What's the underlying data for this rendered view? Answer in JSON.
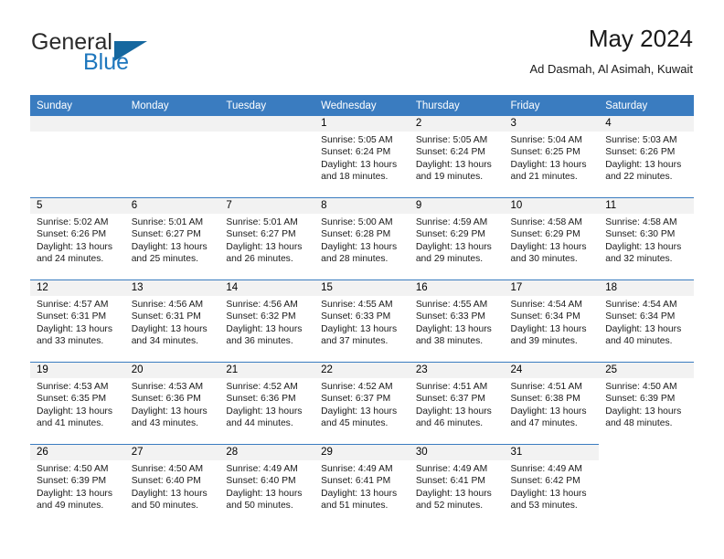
{
  "branding": {
    "logo_text_primary": "General",
    "logo_text_secondary": "Blue",
    "logo_triangle_color": "#15679f",
    "logo_secondary_color": "#1d76bd"
  },
  "header": {
    "title": "May 2024",
    "subtitle": "Ad Dasmah, Al Asimah, Kuwait"
  },
  "theme": {
    "header_bg": "#3a7cc0",
    "daynum_bg": "#f2f2f2",
    "cell_bg": "#ffffff",
    "text": "#1a1a1a"
  },
  "calendar": {
    "weekday_headers": [
      "Sunday",
      "Monday",
      "Tuesday",
      "Wednesday",
      "Thursday",
      "Friday",
      "Saturday"
    ],
    "weeks": [
      [
        {
          "day": "",
          "lines": []
        },
        {
          "day": "",
          "lines": []
        },
        {
          "day": "",
          "lines": []
        },
        {
          "day": "1",
          "lines": [
            "Sunrise: 5:05 AM",
            "Sunset: 6:24 PM",
            "Daylight: 13 hours",
            "and 18 minutes."
          ]
        },
        {
          "day": "2",
          "lines": [
            "Sunrise: 5:05 AM",
            "Sunset: 6:24 PM",
            "Daylight: 13 hours",
            "and 19 minutes."
          ]
        },
        {
          "day": "3",
          "lines": [
            "Sunrise: 5:04 AM",
            "Sunset: 6:25 PM",
            "Daylight: 13 hours",
            "and 21 minutes."
          ]
        },
        {
          "day": "4",
          "lines": [
            "Sunrise: 5:03 AM",
            "Sunset: 6:26 PM",
            "Daylight: 13 hours",
            "and 22 minutes."
          ]
        }
      ],
      [
        {
          "day": "5",
          "lines": [
            "Sunrise: 5:02 AM",
            "Sunset: 6:26 PM",
            "Daylight: 13 hours",
            "and 24 minutes."
          ]
        },
        {
          "day": "6",
          "lines": [
            "Sunrise: 5:01 AM",
            "Sunset: 6:27 PM",
            "Daylight: 13 hours",
            "and 25 minutes."
          ]
        },
        {
          "day": "7",
          "lines": [
            "Sunrise: 5:01 AM",
            "Sunset: 6:27 PM",
            "Daylight: 13 hours",
            "and 26 minutes."
          ]
        },
        {
          "day": "8",
          "lines": [
            "Sunrise: 5:00 AM",
            "Sunset: 6:28 PM",
            "Daylight: 13 hours",
            "and 28 minutes."
          ]
        },
        {
          "day": "9",
          "lines": [
            "Sunrise: 4:59 AM",
            "Sunset: 6:29 PM",
            "Daylight: 13 hours",
            "and 29 minutes."
          ]
        },
        {
          "day": "10",
          "lines": [
            "Sunrise: 4:58 AM",
            "Sunset: 6:29 PM",
            "Daylight: 13 hours",
            "and 30 minutes."
          ]
        },
        {
          "day": "11",
          "lines": [
            "Sunrise: 4:58 AM",
            "Sunset: 6:30 PM",
            "Daylight: 13 hours",
            "and 32 minutes."
          ]
        }
      ],
      [
        {
          "day": "12",
          "lines": [
            "Sunrise: 4:57 AM",
            "Sunset: 6:31 PM",
            "Daylight: 13 hours",
            "and 33 minutes."
          ]
        },
        {
          "day": "13",
          "lines": [
            "Sunrise: 4:56 AM",
            "Sunset: 6:31 PM",
            "Daylight: 13 hours",
            "and 34 minutes."
          ]
        },
        {
          "day": "14",
          "lines": [
            "Sunrise: 4:56 AM",
            "Sunset: 6:32 PM",
            "Daylight: 13 hours",
            "and 36 minutes."
          ]
        },
        {
          "day": "15",
          "lines": [
            "Sunrise: 4:55 AM",
            "Sunset: 6:33 PM",
            "Daylight: 13 hours",
            "and 37 minutes."
          ]
        },
        {
          "day": "16",
          "lines": [
            "Sunrise: 4:55 AM",
            "Sunset: 6:33 PM",
            "Daylight: 13 hours",
            "and 38 minutes."
          ]
        },
        {
          "day": "17",
          "lines": [
            "Sunrise: 4:54 AM",
            "Sunset: 6:34 PM",
            "Daylight: 13 hours",
            "and 39 minutes."
          ]
        },
        {
          "day": "18",
          "lines": [
            "Sunrise: 4:54 AM",
            "Sunset: 6:34 PM",
            "Daylight: 13 hours",
            "and 40 minutes."
          ]
        }
      ],
      [
        {
          "day": "19",
          "lines": [
            "Sunrise: 4:53 AM",
            "Sunset: 6:35 PM",
            "Daylight: 13 hours",
            "and 41 minutes."
          ]
        },
        {
          "day": "20",
          "lines": [
            "Sunrise: 4:53 AM",
            "Sunset: 6:36 PM",
            "Daylight: 13 hours",
            "and 43 minutes."
          ]
        },
        {
          "day": "21",
          "lines": [
            "Sunrise: 4:52 AM",
            "Sunset: 6:36 PM",
            "Daylight: 13 hours",
            "and 44 minutes."
          ]
        },
        {
          "day": "22",
          "lines": [
            "Sunrise: 4:52 AM",
            "Sunset: 6:37 PM",
            "Daylight: 13 hours",
            "and 45 minutes."
          ]
        },
        {
          "day": "23",
          "lines": [
            "Sunrise: 4:51 AM",
            "Sunset: 6:37 PM",
            "Daylight: 13 hours",
            "and 46 minutes."
          ]
        },
        {
          "day": "24",
          "lines": [
            "Sunrise: 4:51 AM",
            "Sunset: 6:38 PM",
            "Daylight: 13 hours",
            "and 47 minutes."
          ]
        },
        {
          "day": "25",
          "lines": [
            "Sunrise: 4:50 AM",
            "Sunset: 6:39 PM",
            "Daylight: 13 hours",
            "and 48 minutes."
          ]
        }
      ],
      [
        {
          "day": "26",
          "lines": [
            "Sunrise: 4:50 AM",
            "Sunset: 6:39 PM",
            "Daylight: 13 hours",
            "and 49 minutes."
          ]
        },
        {
          "day": "27",
          "lines": [
            "Sunrise: 4:50 AM",
            "Sunset: 6:40 PM",
            "Daylight: 13 hours",
            "and 50 minutes."
          ]
        },
        {
          "day": "28",
          "lines": [
            "Sunrise: 4:49 AM",
            "Sunset: 6:40 PM",
            "Daylight: 13 hours",
            "and 50 minutes."
          ]
        },
        {
          "day": "29",
          "lines": [
            "Sunrise: 4:49 AM",
            "Sunset: 6:41 PM",
            "Daylight: 13 hours",
            "and 51 minutes."
          ]
        },
        {
          "day": "30",
          "lines": [
            "Sunrise: 4:49 AM",
            "Sunset: 6:41 PM",
            "Daylight: 13 hours",
            "and 52 minutes."
          ]
        },
        {
          "day": "31",
          "lines": [
            "Sunrise: 4:49 AM",
            "Sunset: 6:42 PM",
            "Daylight: 13 hours",
            "and 53 minutes."
          ]
        }
      ]
    ]
  }
}
